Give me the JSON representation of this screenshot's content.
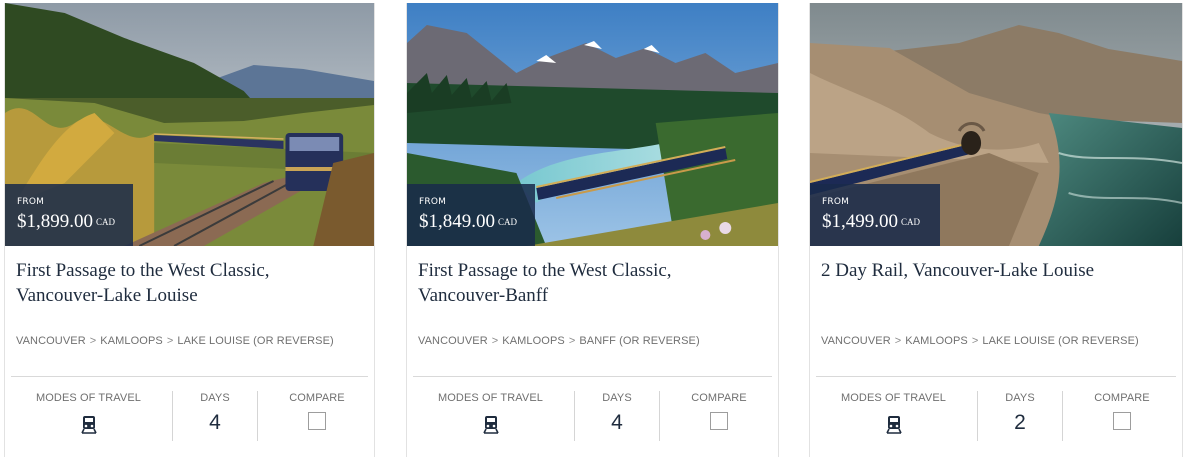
{
  "cards": [
    {
      "price_prefix": "FROM",
      "price": "$1,899.00",
      "currency": "CAD",
      "title": "First Passage to the West Classic, Vancouver-Lake Louise",
      "route": [
        "VANCOUVER",
        "KAMLOOPS",
        "LAKE LOUISE (OR REVERSE)"
      ],
      "modes_label": "MODES OF TRAVEL",
      "modes_icon": "train-icon",
      "days_label": "DAYS",
      "days": "4",
      "compare_label": "COMPARE",
      "compare_checked": false
    },
    {
      "price_prefix": "FROM",
      "price": "$1,849.00",
      "currency": "CAD",
      "title": "First Passage to the West Classic, Vancouver-Banff",
      "route": [
        "VANCOUVER",
        "KAMLOOPS",
        "BANFF (OR REVERSE)"
      ],
      "modes_label": "MODES OF TRAVEL",
      "modes_icon": "train-icon",
      "days_label": "DAYS",
      "days": "4",
      "compare_label": "COMPARE",
      "compare_checked": false
    },
    {
      "price_prefix": "FROM",
      "price": "$1,499.00",
      "currency": "CAD",
      "title": "2 Day Rail, Vancouver-Lake Louise",
      "route": [
        "VANCOUVER",
        "KAMLOOPS",
        "LAKE LOUISE (OR REVERSE)"
      ],
      "modes_label": "MODES OF TRAVEL",
      "modes_icon": "train-icon",
      "days_label": "DAYS",
      "days": "2",
      "compare_label": "COMPARE",
      "compare_checked": false
    }
  ],
  "route_separator": ">",
  "colors": {
    "navy": "#1f2c3e",
    "price_overlay": "#182a4a",
    "muted_text": "#707070",
    "divider": "#d9d9d9"
  }
}
